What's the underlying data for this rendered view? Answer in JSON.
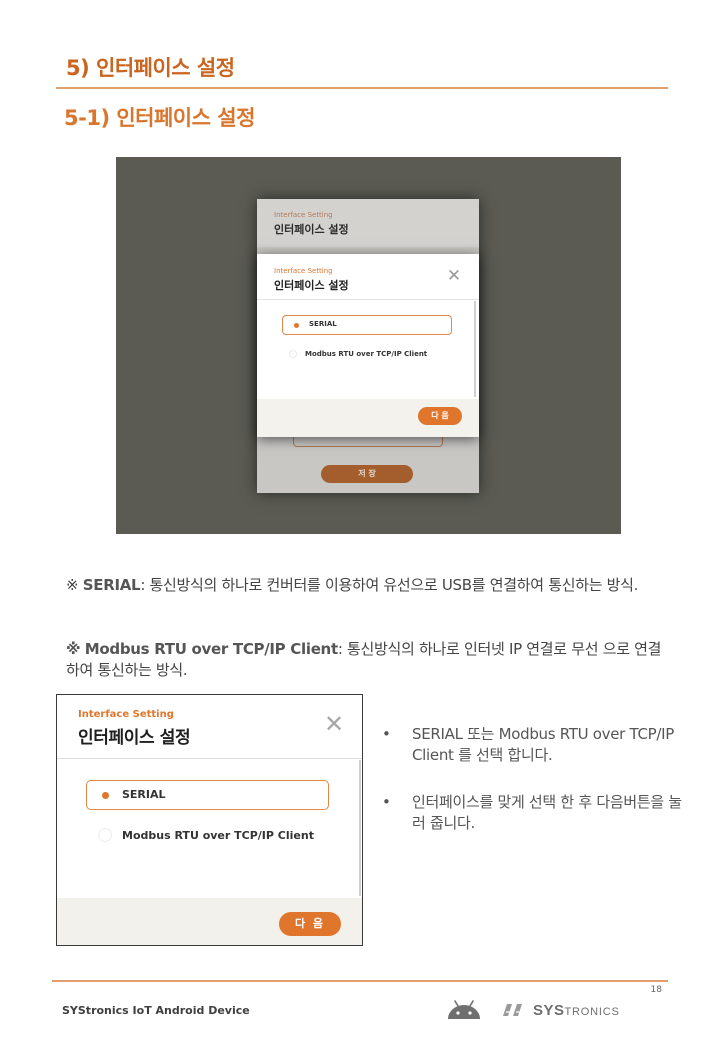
{
  "heading": {
    "section": "5) 인터페이스 설정",
    "subsection": "5-1) 인터페이스 설정"
  },
  "screenshot": {
    "back_dialog": {
      "subtitle": "Interface Setting",
      "title": "인터페이스 설정",
      "save_label": "저 장"
    },
    "dialog": {
      "subtitle": "Interface Setting",
      "title": "인터페이스 설정",
      "close_icon": "close-icon",
      "options": [
        "SERIAL",
        "Modbus RTU over TCP/IP Client"
      ],
      "selected": "SERIAL",
      "next_label": "다 음"
    }
  },
  "notes": [
    {
      "marker": "※",
      "term": "SERIAL",
      "text": ": 통신방식의 하나로 컨버터를 이용하여 유선으로 USB를 연결하여 통신하는 방식."
    },
    {
      "marker": "※",
      "term": "Modbus RTU over TCP/IP Client",
      "text": ": 통신방식의 하나로 인터넷 IP 연결로 무선 으로 연결하여 통신하는 방식."
    }
  ],
  "dialog": {
    "subtitle": "Interface Setting",
    "title": "인터페이스 설정",
    "options": [
      "SERIAL",
      "Modbus RTU over TCP/IP Client"
    ],
    "selected": "SERIAL",
    "next_label": "다 음"
  },
  "bullets": [
    "SERIAL 또는 Modbus RTU over TCP/IP Client 를 선택 합니다.",
    "인터페이스를 맞게 선택 한 후 다음버튼을 눌러 줍니다."
  ],
  "footer": {
    "page_number": "18",
    "brand": "SYStronics IoT Android Device",
    "logo_main": "SYS",
    "logo_tail": "TRONICS"
  },
  "colors": {
    "accent": "#e0762c",
    "heading": "#c9651e"
  }
}
